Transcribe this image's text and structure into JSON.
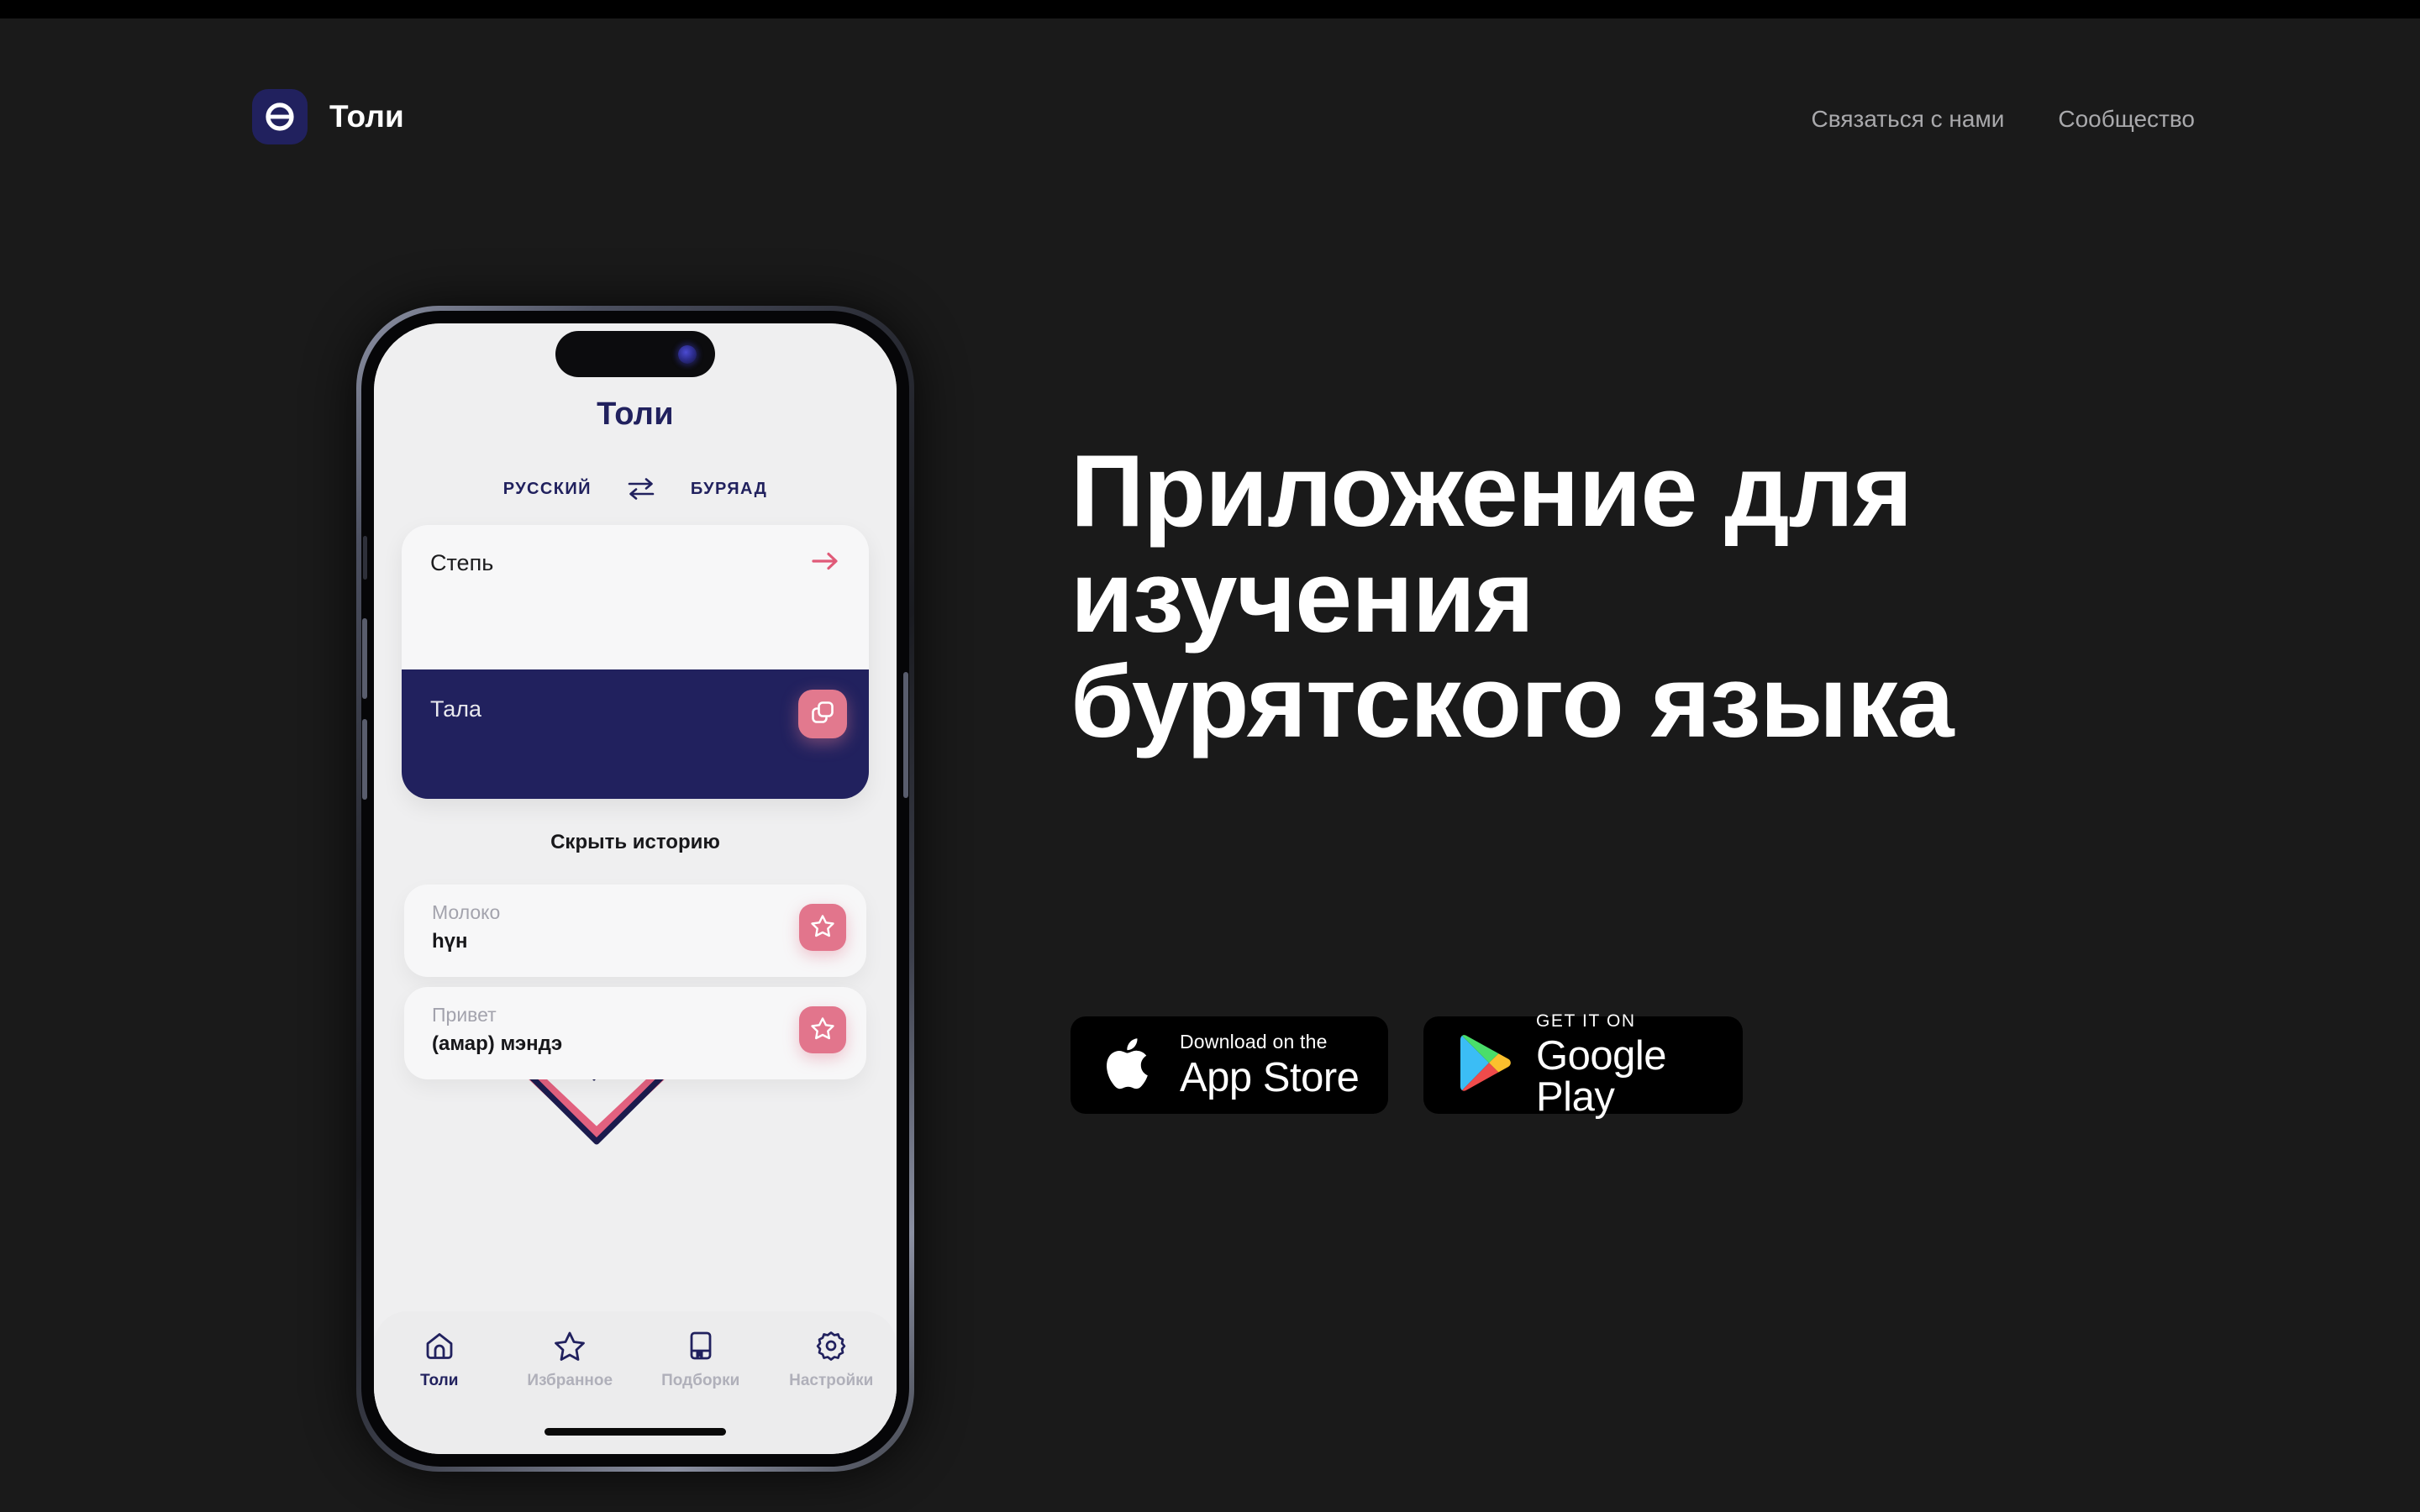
{
  "theme": {
    "page_bg": "#1a1a1a",
    "navy": "#21215e",
    "pink": "#e2798e",
    "screen_bg": "#efeff0",
    "white": "#ffffff",
    "nav_grey": "#a9a9ac"
  },
  "header": {
    "brand_name": "Толи",
    "logo_glyph": "Ө",
    "nav": [
      {
        "label": "Связаться с нами"
      },
      {
        "label": "Сообщество"
      }
    ]
  },
  "hero": {
    "title": "Приложение для изучения бурятского языка",
    "badges": [
      {
        "small": "Download on the",
        "big": "App Store",
        "icon": "apple-icon"
      },
      {
        "small": "GET IT ON",
        "big": "Google Play",
        "icon": "google-play-icon"
      }
    ]
  },
  "phone": {
    "app": {
      "title": "Толи",
      "language_switch": {
        "source": "РУССКИЙ",
        "target": "БУРЯАД",
        "swap_icon": "swap-arrows-icon"
      },
      "translation": {
        "input_text": "Степь",
        "input_action_icon": "arrow-right-icon",
        "output_text": "Тала",
        "output_action_icon": "copy-icon"
      },
      "history_toggle": "Скрыть историю",
      "history": [
        {
          "source": "Молоко",
          "target": "һүн",
          "action_icon": "star-icon"
        },
        {
          "source": "Привет",
          "target": "(амар) мэндэ",
          "action_icon": "star-icon"
        }
      ],
      "tabs": [
        {
          "label": "Толи",
          "icon": "home-icon",
          "active": true
        },
        {
          "label": "Избранное",
          "icon": "star-icon",
          "active": false
        },
        {
          "label": "Подборки",
          "icon": "book-bookmark-icon",
          "active": false
        },
        {
          "label": "Настройки",
          "icon": "gear-icon",
          "active": false
        }
      ]
    }
  }
}
